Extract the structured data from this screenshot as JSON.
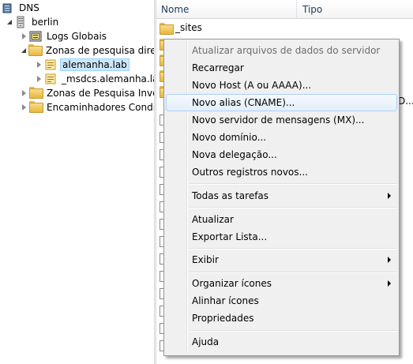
{
  "tree": {
    "root": "DNS",
    "server": "berlin",
    "items": [
      {
        "label": "Logs Globais"
      },
      {
        "label": "Zonas de pesquisa direta"
      },
      {
        "label": "alemanha.lab"
      },
      {
        "label": "_msdcs.alemanha.lab"
      },
      {
        "label": "Zonas de Pesquisa Inversa"
      },
      {
        "label": "Encaminhadores Condicionais"
      }
    ]
  },
  "list": {
    "columns": [
      "Nome",
      "Tipo"
    ],
    "rows": [
      {
        "name": "_sites",
        "type": ""
      }
    ],
    "clipped_type_text": "D..."
  },
  "menu": {
    "items": [
      {
        "label": "Atualizar arquivos de dados do servidor",
        "disabled": true
      },
      {
        "label": "Recarregar"
      },
      {
        "label": "Novo Host (A ou AAAA)..."
      },
      {
        "label": "Novo alias (CNAME)...",
        "highlighted": true
      },
      {
        "label": "Novo servidor de mensagens (MX)..."
      },
      {
        "label": "Novo domínio..."
      },
      {
        "label": "Nova delegação..."
      },
      {
        "label": "Outros registros novos..."
      },
      {
        "label": "Todas as tarefas",
        "submenu": true
      },
      {
        "label": "Atualizar"
      },
      {
        "label": "Exportar Lista..."
      },
      {
        "label": "Exibir",
        "submenu": true
      },
      {
        "label": "Organizar ícones",
        "submenu": true
      },
      {
        "label": "Alinhar ícones"
      },
      {
        "label": "Propriedades"
      },
      {
        "label": "Ajuda"
      }
    ]
  },
  "colors": {
    "selection": "#cce8ff",
    "menu_hover": "#aecff7",
    "folder": "#e8b740"
  }
}
